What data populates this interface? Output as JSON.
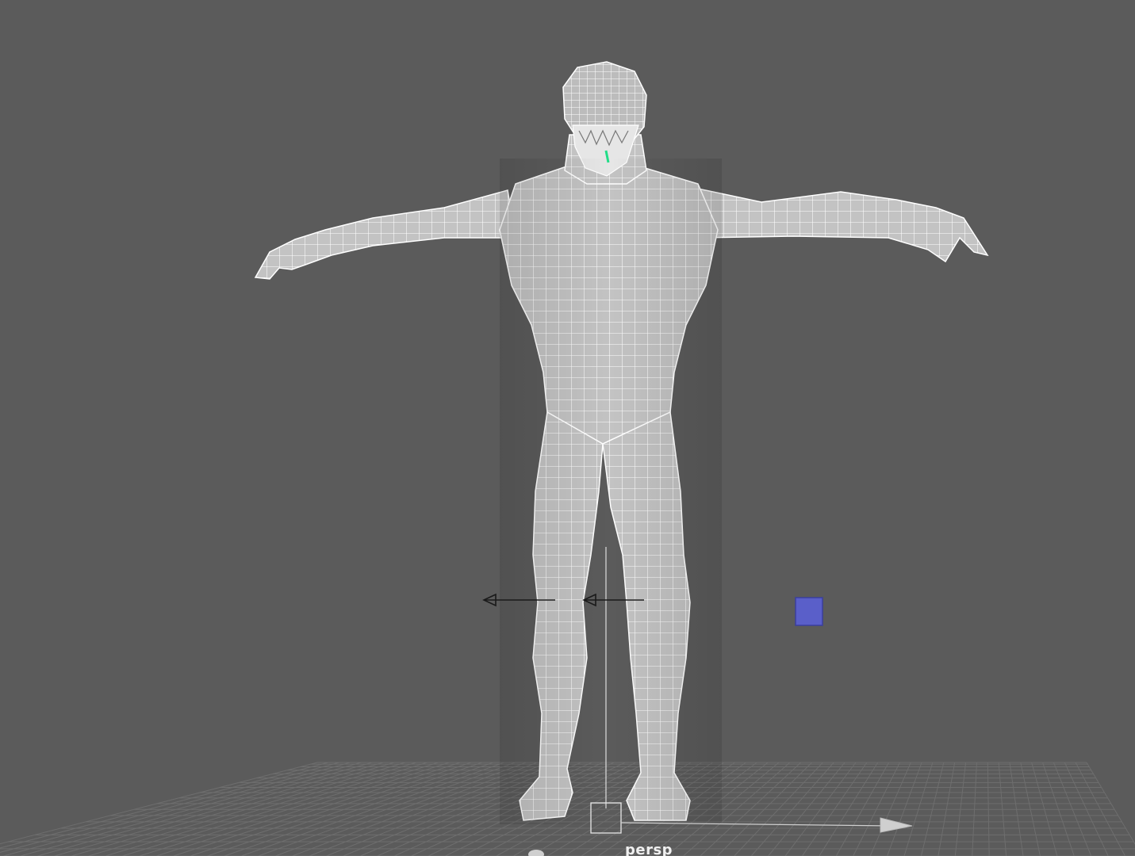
{
  "viewport": {
    "camera_label": "persp",
    "background_color": "#5b5b5b",
    "grid_color": "#6e6e6e",
    "mesh_fill_color": "#c4c4c4",
    "wireframe_color": "#ffffff",
    "handle_color": "#5a5fc9",
    "manipulator_color": "#1a1a1a"
  }
}
